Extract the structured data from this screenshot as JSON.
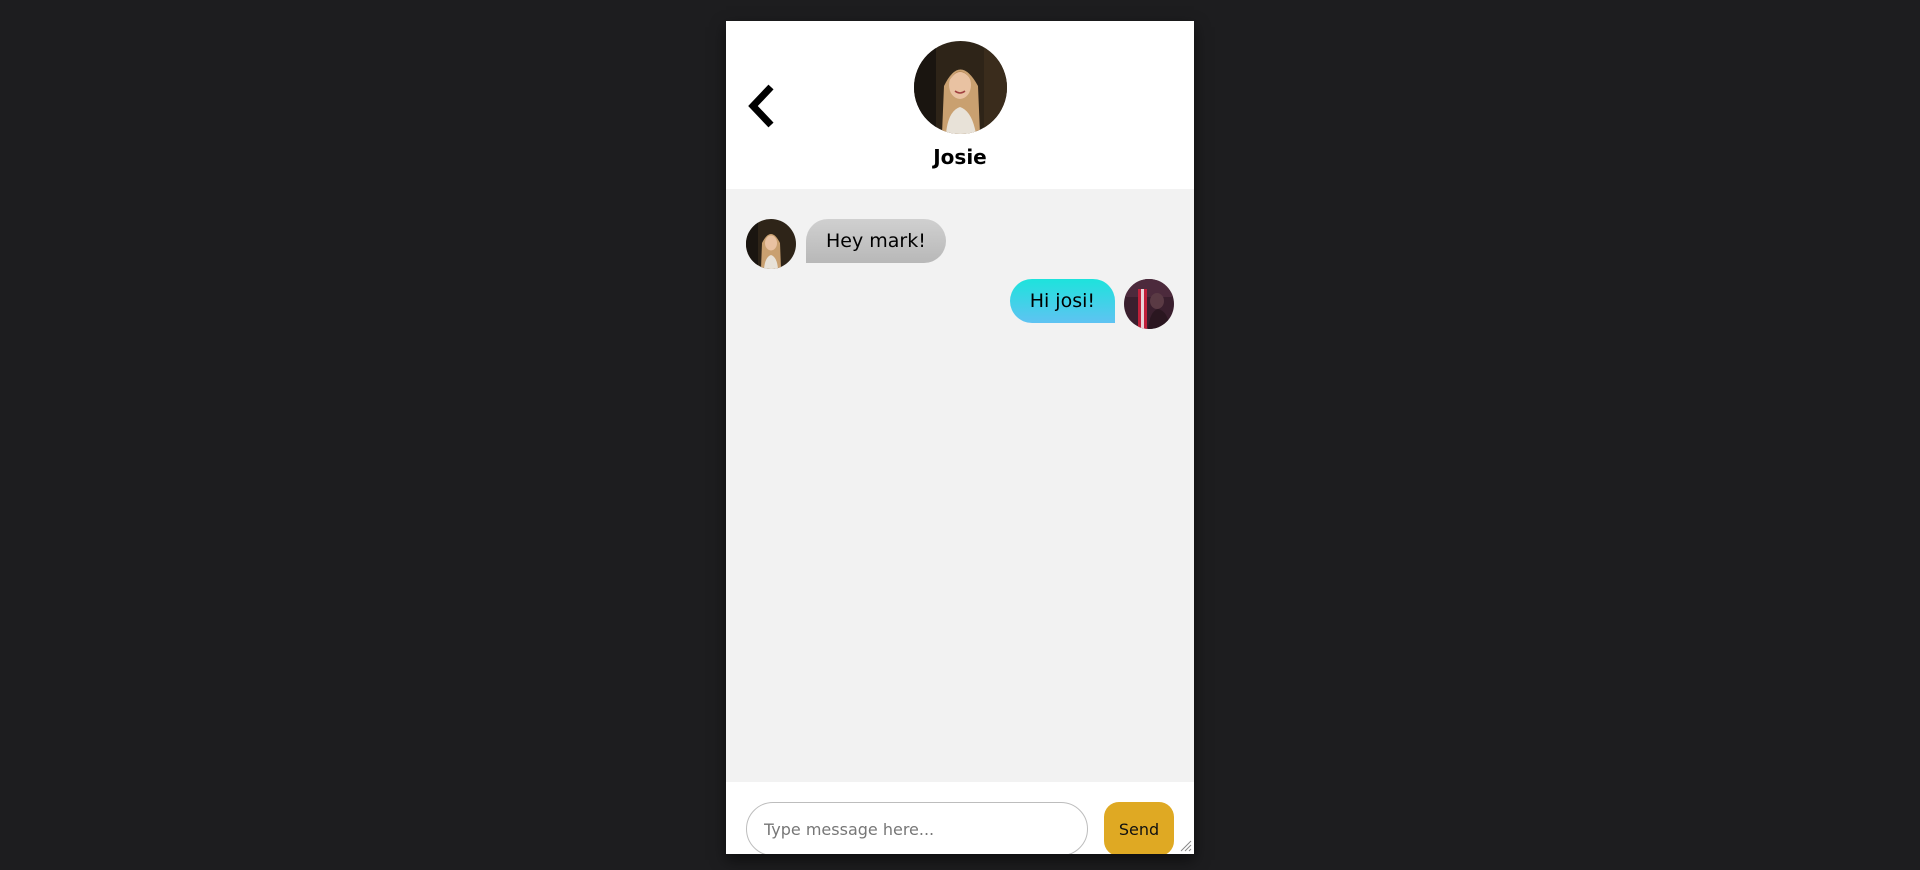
{
  "header": {
    "contact_name": "Josie",
    "back_icon": "chevron-left-icon"
  },
  "messages": [
    {
      "direction": "incoming",
      "text": "Hey mark!",
      "sender": "Josie"
    },
    {
      "direction": "outgoing",
      "text": "Hi josi!"
    }
  ],
  "composer": {
    "placeholder": "Type message here...",
    "value": "",
    "send_label": "Send"
  },
  "colors": {
    "page_background": "#1d1d1f",
    "chat_background": "#f2f2f2",
    "incoming_bubble": "#c4c4c4",
    "outgoing_bubble_top": "#1de3dc",
    "outgoing_bubble_bottom": "#5fc3f2",
    "send_button": "#dfa923"
  }
}
